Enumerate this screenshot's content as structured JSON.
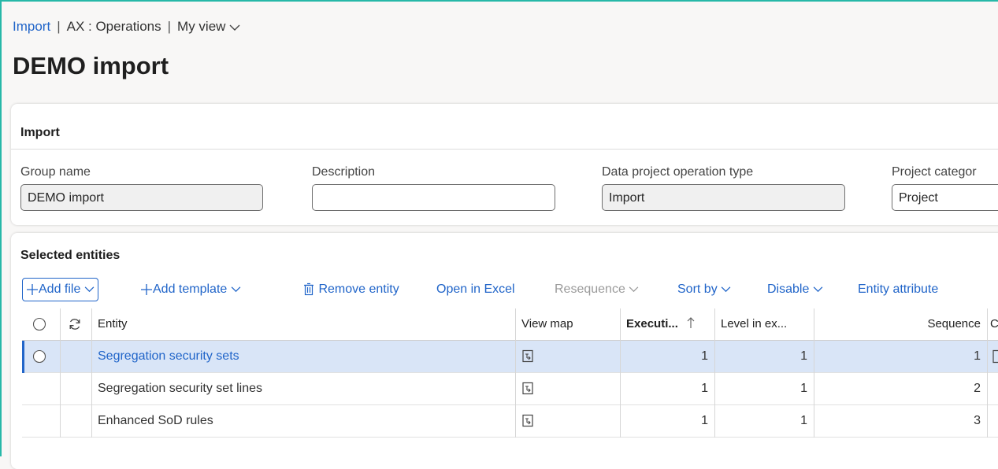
{
  "breadcrumb": {
    "link": "Import",
    "company": "AX : Operations",
    "view": "My view"
  },
  "page_title": "DEMO import",
  "import_section": {
    "title": "Import",
    "fields": {
      "group_name": {
        "label": "Group name",
        "value": "DEMO import"
      },
      "description": {
        "label": "Description",
        "value": ""
      },
      "operation_type": {
        "label": "Data project operation type",
        "value": "Import"
      },
      "project_category": {
        "label": "Project categor",
        "value": "Project"
      }
    }
  },
  "entities_section": {
    "title": "Selected entities",
    "toolbar": {
      "add_file": "Add file",
      "add_template": "Add template",
      "remove_entity": "Remove entity",
      "open_in_excel": "Open in Excel",
      "resequence": "Resequence",
      "sort_by": "Sort by",
      "disable": "Disable",
      "entity_attribute": "Entity attribute"
    },
    "columns": {
      "entity": "Entity",
      "view_map": "View map",
      "execution": "Executi...",
      "level": "Level in ex...",
      "sequence": "Sequence",
      "overflow": "C"
    },
    "rows": [
      {
        "entity": "Segregation security sets",
        "execution": "1",
        "level": "1",
        "sequence": "1"
      },
      {
        "entity": "Segregation security set lines",
        "execution": "1",
        "level": "1",
        "sequence": "2"
      },
      {
        "entity": "Enhanced SoD rules",
        "execution": "1",
        "level": "1",
        "sequence": "3"
      }
    ]
  },
  "icons": [
    "chevron-down-icon",
    "plus-icon",
    "trash-icon",
    "select-all-icon",
    "refresh-icon",
    "sort-up-icon",
    "view-map-icon",
    "radio-icon"
  ],
  "colors": {
    "accent": "#2165c9",
    "selected_row": "#d9e5f7",
    "frame": "#27b8a8"
  }
}
